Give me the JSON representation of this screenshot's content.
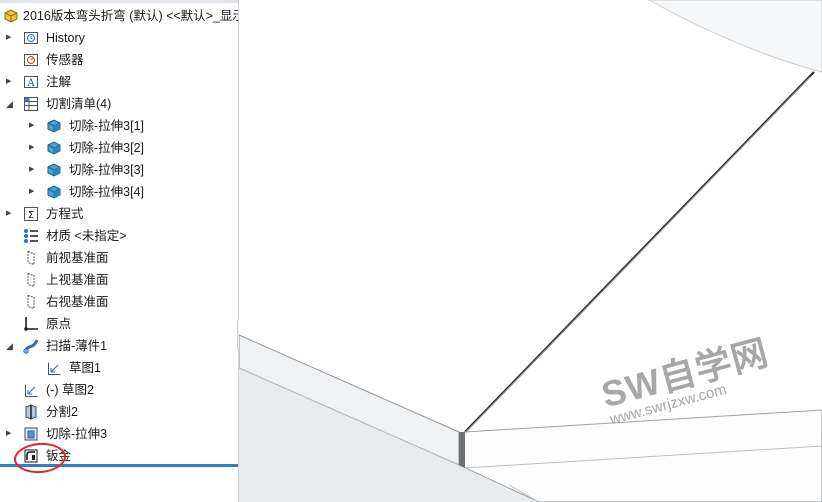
{
  "root": {
    "label": "2016版本弯头折弯 (默认) <<默认>_显示"
  },
  "tree": [
    {
      "label": "History",
      "icon": "history-folder-icon",
      "expand": "collapsed",
      "level": 0
    },
    {
      "label": "传感器",
      "icon": "sensor-icon",
      "expand": "none",
      "level": 0
    },
    {
      "label": "注解",
      "icon": "annotation-icon",
      "expand": "collapsed",
      "level": 0
    },
    {
      "label": "切割清单(4)",
      "icon": "cut-list-icon",
      "expand": "expanded",
      "level": 0
    },
    {
      "label": "切除-拉伸3[1]",
      "icon": "solid-body-icon",
      "expand": "collapsed",
      "level": 1
    },
    {
      "label": "切除-拉伸3[2]",
      "icon": "solid-body-icon",
      "expand": "collapsed",
      "level": 1
    },
    {
      "label": "切除-拉伸3[3]",
      "icon": "solid-body-icon",
      "expand": "collapsed",
      "level": 1
    },
    {
      "label": "切除-拉伸3[4]",
      "icon": "solid-body-icon",
      "expand": "collapsed",
      "level": 1
    },
    {
      "label": "方程式",
      "icon": "equation-icon",
      "expand": "collapsed",
      "level": 0
    },
    {
      "label": "材质 <未指定>",
      "icon": "material-icon",
      "expand": "none",
      "level": 0
    },
    {
      "label": "前视基准面",
      "icon": "plane-icon",
      "expand": "none",
      "level": 0
    },
    {
      "label": "上视基准面",
      "icon": "plane-icon",
      "expand": "none",
      "level": 0
    },
    {
      "label": "右视基准面",
      "icon": "plane-icon",
      "expand": "none",
      "level": 0
    },
    {
      "label": "原点",
      "icon": "origin-icon",
      "expand": "none",
      "level": 0
    },
    {
      "label": "扫描-薄件1",
      "icon": "sweep-icon",
      "expand": "expanded",
      "level": 0
    },
    {
      "label": "草图1",
      "icon": "sketch-icon",
      "expand": "none",
      "level": 1
    },
    {
      "label": "(-) 草图2",
      "icon": "sketch-icon",
      "expand": "none",
      "level": 0
    },
    {
      "label": "分割2",
      "icon": "split-icon",
      "expand": "none",
      "level": 0
    },
    {
      "label": "切除-拉伸3",
      "icon": "extrude-cut-icon",
      "expand": "collapsed",
      "level": 0
    },
    {
      "label": "钣金",
      "icon": "sheet-metal-icon",
      "expand": "none",
      "level": 0
    }
  ],
  "watermark": {
    "line1": "SW自学网",
    "line2": "www.swrjzxw.com"
  }
}
